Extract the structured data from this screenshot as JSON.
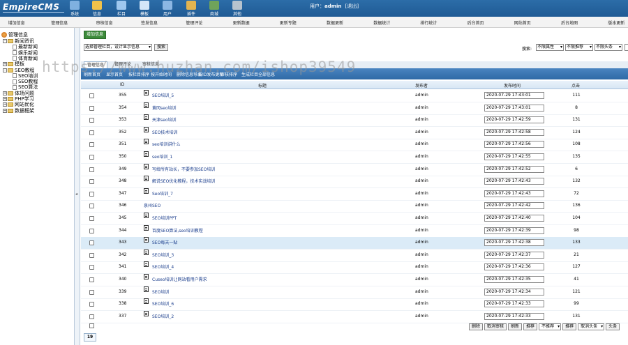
{
  "header": {
    "logo": "EmpireCMS",
    "nav": [
      {
        "label": "系统",
        "icon": "system-icon",
        "color": "#7fb0e0"
      },
      {
        "label": "信息",
        "icon": "info-icon",
        "color": "#f2c24a"
      },
      {
        "label": "栏目",
        "icon": "column-icon",
        "color": "#9ec7ef"
      },
      {
        "label": "模板",
        "icon": "template-icon",
        "color": "#d3e6f8"
      },
      {
        "label": "用户",
        "icon": "user-icon",
        "color": "#8cb7e3"
      },
      {
        "label": "插件",
        "icon": "plugin-icon",
        "color": "#e2b450"
      },
      {
        "label": "商城",
        "icon": "shop-icon",
        "color": "#6fa35a"
      },
      {
        "label": "其他",
        "icon": "other-icon",
        "color": "#b7c3ce"
      }
    ],
    "user_prefix": "用户：",
    "username": "admin",
    "logout": "[退出]"
  },
  "menubar": [
    "增加信息",
    "管理信息",
    "审核信息",
    "签发信息",
    "管理评论",
    "更新数据",
    "更新专题",
    "数据更新",
    "数据统计",
    "排行统计",
    "后台首页",
    "网站首页",
    "后台地图",
    "版本更新"
  ],
  "tree": {
    "root": "管理信息",
    "items": [
      {
        "label": "新闻资讯",
        "level": 1,
        "type": "folder",
        "box": "-"
      },
      {
        "label": "最新新闻",
        "level": 2,
        "type": "doc"
      },
      {
        "label": "娱乐新闻",
        "level": 2,
        "type": "doc"
      },
      {
        "label": "体育新闻",
        "level": 2,
        "type": "doc"
      },
      {
        "label": "模板",
        "level": 1,
        "type": "folder",
        "box": "+"
      },
      {
        "label": "SEO教程",
        "level": 1,
        "type": "folder",
        "box": "-"
      },
      {
        "label": "SEO培训",
        "level": 2,
        "type": "doc"
      },
      {
        "label": "SEO教程",
        "level": 2,
        "type": "doc"
      },
      {
        "label": "SEO算法",
        "level": 2,
        "type": "doc"
      },
      {
        "label": "体场问题",
        "level": 1,
        "type": "folder",
        "box": "+"
      },
      {
        "label": "PHP学习",
        "level": 1,
        "type": "folder",
        "box": "+"
      },
      {
        "label": "网站优化",
        "level": 1,
        "type": "folder",
        "box": "+"
      },
      {
        "label": "数据框架",
        "level": 1,
        "type": "folder",
        "box": "+"
      }
    ]
  },
  "main": {
    "add_button": "增加信息",
    "filter_select": "选择管理栏目，设计显示信息",
    "filter_button": "搜索",
    "search_label": "搜索:",
    "dd_flag": "不限属性",
    "dd_audit": "不限推荐",
    "dd_head": "不限头条",
    "tabs": [
      "管理信息",
      "管理评论",
      "审核信息"
    ],
    "toolbar": [
      "刷新首页",
      "显示首页",
      "按栏目排序",
      "按开始时间",
      "删除信息导出",
      "按ID发布更新",
      "审核排序",
      "生成栏目全部信息"
    ],
    "columns": {
      "id": "ID",
      "title": "标题",
      "author": "发布者",
      "time": "发布时间",
      "clicks": "点击"
    },
    "rows": [
      {
        "id": "355",
        "title": "SEO培训_5",
        "author": "admin",
        "time": "2020-07-29 17:43:01",
        "clicks": "111",
        "icon": true
      },
      {
        "id": "354",
        "title": "黄冈seo培训",
        "author": "admin",
        "time": "2020-07-29 17:43:01",
        "clicks": "8",
        "icon": true
      },
      {
        "id": "353",
        "title": "天津seo培训",
        "author": "admin",
        "time": "2020-07-29 17:42:59",
        "clicks": "131",
        "icon": true
      },
      {
        "id": "352",
        "title": "SEO技术培训",
        "author": "admin",
        "time": "2020-07-29 17:42:58",
        "clicks": "124",
        "icon": true
      },
      {
        "id": "351",
        "title": "seo培训讲什么",
        "author": "admin",
        "time": "2020-07-29 17:42:56",
        "clicks": "108",
        "icon": true
      },
      {
        "id": "350",
        "title": "seo培训_1",
        "author": "admin",
        "time": "2020-07-29 17:42:55",
        "clicks": "135",
        "icon": true
      },
      {
        "id": "349",
        "title": "写给所有站长，不要参加SEO培训",
        "author": "admin",
        "time": "2020-07-29 17:42:52",
        "clicks": "6",
        "icon": true
      },
      {
        "id": "348",
        "title": "解说SEO优化教程，技术实战培训",
        "author": "admin",
        "time": "2020-07-29 17:42:43",
        "clicks": "132",
        "icon": true
      },
      {
        "id": "347",
        "title": "Seo培训_7",
        "author": "admin",
        "time": "2020-07-29 17:42:43",
        "clicks": "72",
        "icon": true
      },
      {
        "id": "346",
        "title": "泉州SEO",
        "author": "admin",
        "time": "2020-07-29 17:42:42",
        "clicks": "136",
        "icon": false
      },
      {
        "id": "345",
        "title": "SEO培训PPT",
        "author": "admin",
        "time": "2020-07-29 17:42:40",
        "clicks": "104",
        "icon": true
      },
      {
        "id": "344",
        "title": "百度SEO算法,seo培训教程",
        "author": "admin",
        "time": "2020-07-29 17:42:39",
        "clicks": "98",
        "icon": true
      },
      {
        "id": "343",
        "title": "SEO每天一贴",
        "author": "admin",
        "time": "2020-07-29 17:42:38",
        "clicks": "133",
        "icon": true
      },
      {
        "id": "342",
        "title": "SEO培训_3",
        "author": "admin",
        "time": "2020-07-29 17:42:37",
        "clicks": "21",
        "icon": true
      },
      {
        "id": "341",
        "title": "SEO培训_4",
        "author": "admin",
        "time": "2020-07-29 17:42:36",
        "clicks": "127",
        "icon": true
      },
      {
        "id": "340",
        "title": "Cuseo培训让网站看用户需求",
        "author": "admin",
        "time": "2020-07-29 17:42:35",
        "clicks": "41",
        "icon": true
      },
      {
        "id": "339",
        "title": "SEO培训",
        "author": "admin",
        "time": "2020-07-29 17:42:34",
        "clicks": "121",
        "icon": true
      },
      {
        "id": "338",
        "title": "SEO培训_6",
        "author": "admin",
        "time": "2020-07-29 17:42:33",
        "clicks": "99",
        "icon": true
      },
      {
        "id": "337",
        "title": "SEO培训_2",
        "author": "admin",
        "time": "2020-07-29 17:42:33",
        "clicks": "131",
        "icon": true
      }
    ],
    "highlight_row": "343",
    "footer_buttons": [
      "删除",
      "取消审核",
      "刷新",
      "推荐",
      "不推荐",
      "推荐",
      "取消头条",
      "头条"
    ],
    "pager": "19"
  },
  "watermark": "https://www.huzhan.com/ishop39549"
}
